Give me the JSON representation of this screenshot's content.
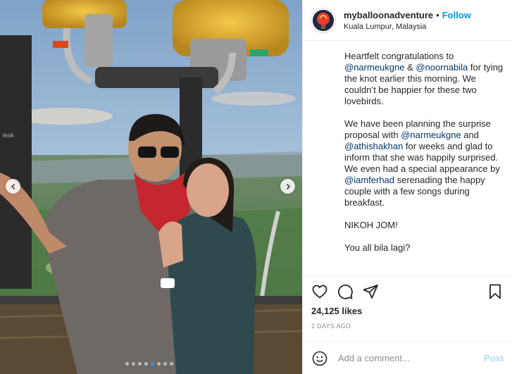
{
  "header": {
    "username": "myballoonadventure",
    "separator": "•",
    "follow_label": "Follow",
    "location": "Kuala Lumpur, Malaysia"
  },
  "caption": {
    "p1": {
      "t1": "Heartfelt congratulations to ",
      "m1": "@narmeukgne",
      "t2": " & ",
      "m2": "@noornabila",
      "t3": " for tying the knot earlier this morning. We couldn’t be happier for these two lovebirds."
    },
    "p2": {
      "t1": "We have been planning the surprise proposal with ",
      "m1": "@narmeukgne",
      "t2": " and ",
      "m2": "@athishakhan",
      "t3": " for weeks and glad to inform that she was happily surprised. We even had a special appearance by ",
      "m3": "@iamferhad",
      "t4": " serenading the happy couple with a few songs during breakfast."
    },
    "p3": "NIKOH JOM!",
    "p4": "You all bila lagi?"
  },
  "actions": {
    "icons": [
      "heart-icon",
      "comment-icon",
      "share-icon",
      "bookmark-icon"
    ],
    "likes": "24,125 likes",
    "time_ago": "2 DAYS AGO"
  },
  "comment": {
    "placeholder": "Add a comment...",
    "post_label": "Post"
  },
  "media": {
    "slides_total": 8,
    "active_slide": 5,
    "prev_icon": "chevron-left-icon",
    "next_icon": "chevron-right-icon"
  },
  "colors": {
    "accent": "#0095f6",
    "mention": "#00376b",
    "post_disabled": "#b2dffc",
    "dot_active": "#3897f0"
  }
}
